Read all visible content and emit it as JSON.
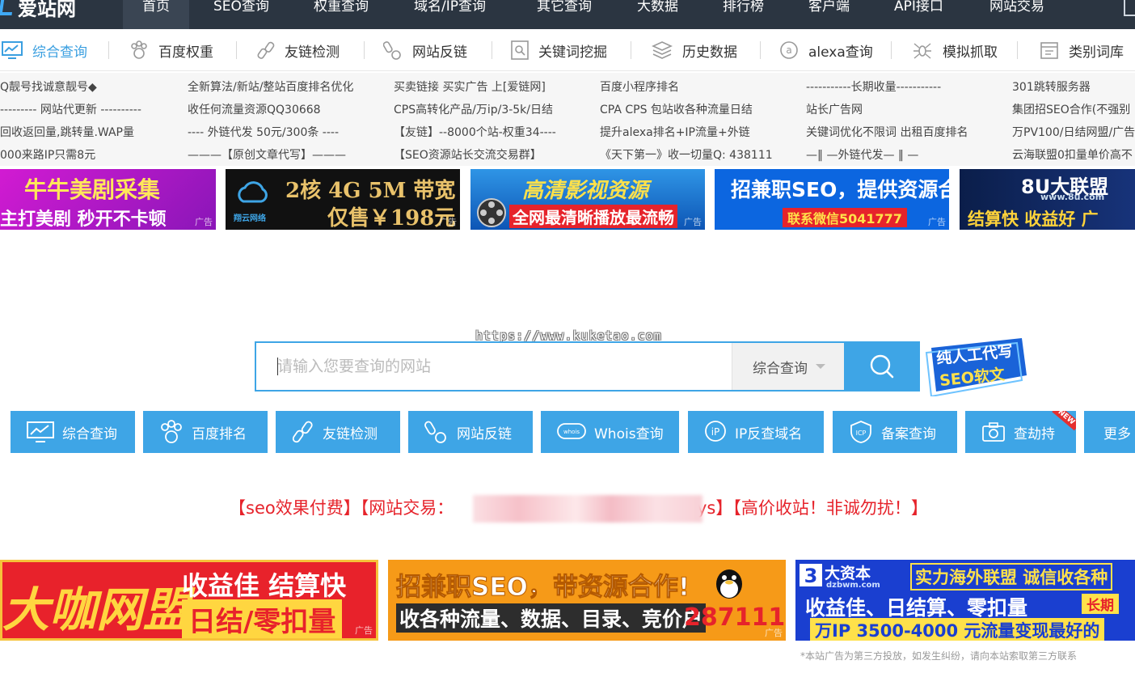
{
  "brand": {
    "name": "爱站网"
  },
  "nav": [
    {
      "label": "首页",
      "active": true
    },
    {
      "label": "SEO查询"
    },
    {
      "label": "权重查询"
    },
    {
      "label": "域名/IP查询"
    },
    {
      "label": "其它查询"
    },
    {
      "label": "大数据"
    },
    {
      "label": "排行榜"
    },
    {
      "label": "客户端"
    },
    {
      "label": "API接口"
    },
    {
      "label": "网站交易"
    }
  ],
  "tools": [
    {
      "label": "综合查询",
      "icon": "monitor-chart-icon",
      "active": true
    },
    {
      "label": "百度权重",
      "icon": "baidu-paw-icon"
    },
    {
      "label": "友链检测",
      "icon": "chain-link-icon"
    },
    {
      "label": "网站反链",
      "icon": "backlink-icon"
    },
    {
      "label": "关键词挖掘",
      "icon": "keyword-search-icon"
    },
    {
      "label": "历史数据",
      "icon": "stack-layers-icon"
    },
    {
      "label": "alexa查询",
      "icon": "alexa-a-icon"
    },
    {
      "label": "模拟抓取",
      "icon": "spider-icon"
    },
    {
      "label": "类别词库",
      "icon": "category-box-icon"
    }
  ],
  "ad_links": [
    [
      "Q靓号找诚意靓号◆",
      "--------- 网站代更新 ----------",
      "回收返回量,跳转量.WAP量",
      "000来路IP只需8元"
    ],
    [
      "全新算法/新站/整站百度排名优化",
      "收任何流量资源QQ30668",
      "---- 外链代发 50元/300条 ----",
      "———【原创文章代写】———"
    ],
    [
      "买卖链接 买实广告 上[爱链网]",
      "CPS高转化产品/万ip/3-5k/日结",
      "【友链】--8000个站-权重34----",
      "【SEO资源站长交流交易群】"
    ],
    [
      "百度小程序排名",
      "CPA CPS 包站收各种流量日结",
      "提升alexa排名+IP流量+外链",
      "《天下第一》收一切量Q: 438111"
    ],
    [
      "-----------长期收量-----------",
      "站长广告网",
      "关键词优化不限词 出租百度排名",
      "—‖ —外链代发— ‖ —"
    ],
    [
      "301跳转服务器",
      "集团招SEO合作(不强别",
      "万PV100/日结网盟/广告",
      "云海联盟0扣量单价高不"
    ]
  ],
  "banners_top": [
    {
      "line1": "牛牛美剧采集",
      "line2": "主打美剧  秒开不卡顿",
      "bg": "#c41bc9"
    },
    {
      "line1": "2核 4G 5M 带宽",
      "line2": "仅售￥198元",
      "brand": "翔云网络",
      "bg": "#0e0e0e"
    },
    {
      "line1": "高清影视资源",
      "line2": "全网最清晰播放最流畅",
      "bg": "#1a78c8"
    },
    {
      "line1": "招兼职SEO，提供资源合作",
      "line2": "联系微信5041777",
      "bg": "#0c66e0"
    },
    {
      "line1": "8U大联盟",
      "sub": "www.8u.com",
      "line2": "结算快   收益好   广",
      "bg": "#0b1e4a"
    }
  ],
  "ad_tag": "广告",
  "search": {
    "watermark": "https://www.kuketao.com",
    "placeholder": "请输入您要查询的网站",
    "select_value": "综合查询"
  },
  "side_badge": {
    "line1": "纯人工代写",
    "line2": "SEO软文"
  },
  "quick_buttons": [
    {
      "label": "综合查询",
      "icon": "monitor-chart-icon"
    },
    {
      "label": "百度排名",
      "icon": "baidu-paw-icon"
    },
    {
      "label": "友链检测",
      "icon": "chain-link-icon"
    },
    {
      "label": "网站反链",
      "icon": "backlink-icon"
    },
    {
      "label": "Whois查询",
      "icon": "whois-cloud-icon"
    },
    {
      "label": "IP反查域名",
      "icon": "ip-pin-icon"
    },
    {
      "label": "备案查询",
      "icon": "icp-shield-icon"
    },
    {
      "label": "查劫持",
      "icon": "camera-icon",
      "tag": "NEW"
    },
    {
      "label": "更多"
    }
  ],
  "notice": {
    "left": "【seo效果付费】【网站交易：",
    "right": "ys】【高价收站！非诚勿扰！】"
  },
  "banners_bottom": [
    {
      "line1": "大咖网盟",
      "line2": "收益佳 结算快",
      "line3": "日结/零扣量"
    },
    {
      "line1": "招兼职SEO，带资源合作!",
      "line2": "收各种流量、数据、目录、竞价户",
      "number": "287111"
    },
    {
      "brand": "大资本",
      "brand_sub": "dzbwm.com",
      "line1": "实力海外联盟 诚信收各种",
      "line2": "收益佳、日结算、零扣量",
      "tag": "长期",
      "line3": "万IP 3500-4000 元流量变现最好的"
    }
  ],
  "footer_note": "*本站广告为第三方投放，如发生纠纷，请向本站索取第三方联系"
}
